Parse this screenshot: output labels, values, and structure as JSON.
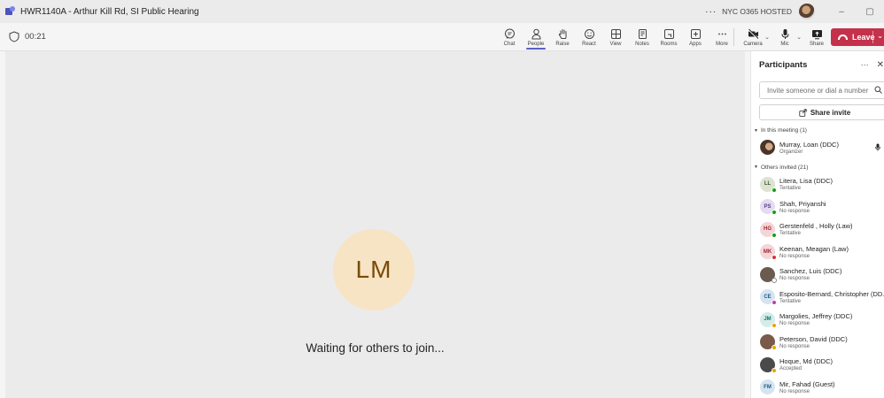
{
  "window": {
    "title": "HWR1140A - Arthur Kill Rd, SI Public Hearing",
    "more_label": "···",
    "org": "NYC O365 HOSTED",
    "minimize": "–",
    "restore": "▢"
  },
  "toolbar": {
    "timer": "00:21",
    "actions": [
      {
        "label": "Chat",
        "icon": "chat-icon"
      },
      {
        "label": "People",
        "icon": "people-icon",
        "active": true
      },
      {
        "label": "Raise",
        "icon": "hand-icon"
      },
      {
        "label": "React",
        "icon": "smile-icon"
      },
      {
        "label": "View",
        "icon": "grid-icon"
      },
      {
        "label": "Notes",
        "icon": "notes-icon"
      },
      {
        "label": "Rooms",
        "icon": "rooms-icon"
      },
      {
        "label": "Apps",
        "icon": "apps-icon"
      },
      {
        "label": "More",
        "icon": "more-icon"
      }
    ],
    "camera_label": "Camera",
    "mic_label": "Mic",
    "share_label": "Share",
    "leave_label": "Leave"
  },
  "stage": {
    "initials": "LM",
    "waiting_text": "Waiting for others to join..."
  },
  "participants": {
    "title": "Participants",
    "more": "···",
    "close": "✕",
    "invite_placeholder": "Invite someone or dial a number",
    "share_invite": "Share invite",
    "in_meeting_header": "In this meeting (1)",
    "in_meeting": [
      {
        "name": "Murray, Loan (DDC)",
        "status": "Organizer"
      }
    ],
    "others_header": "Others invited (21)",
    "others": [
      {
        "initials": "LL",
        "name": "Litera, Lisa (DDC)",
        "status": "Tentative",
        "bg": "#dce3d3",
        "fg": "#405b2e",
        "presence": "#13a10e"
      },
      {
        "initials": "PS",
        "name": "Shah, Priyanshi",
        "status": "No response",
        "bg": "#e3dcf0",
        "fg": "#5b3c88",
        "presence": "#13a10e"
      },
      {
        "initials": "HG",
        "name": "Gerstenfeld , Holly (Law)",
        "status": "Tentative",
        "bg": "#f3d6d8",
        "fg": "#a4262c",
        "presence": "#13a10e"
      },
      {
        "initials": "MK",
        "name": "Keenan, Meagan (Law)",
        "status": "No response",
        "bg": "#f3d6d8",
        "fg": "#a4262c",
        "presence": "#d13438"
      },
      {
        "initials": "",
        "name": "Sanchez, Luis (DDC)",
        "status": "No response",
        "bg": "#6b5a4e",
        "fg": "#fff",
        "presence": "#ffffff"
      },
      {
        "initials": "CE",
        "name": "Esposito-Bernard, Christopher (DD...",
        "status": "Tentative",
        "bg": "#d6e4f0",
        "fg": "#1d5a8a",
        "presence": "#c239b3"
      },
      {
        "initials": "JM",
        "name": "Margolies, Jeffrey (DDC)",
        "status": "No response",
        "bg": "#d6ece9",
        "fg": "#117865",
        "presence": "#eaa300"
      },
      {
        "initials": "",
        "name": "Peterson, David (DDC)",
        "status": "No response",
        "bg": "#7a5a48",
        "fg": "#fff",
        "presence": "#eaa300"
      },
      {
        "initials": "",
        "name": "Hoque, Md (DDC)",
        "status": "Accepted",
        "bg": "#4a4a4a",
        "fg": "#fff",
        "presence": "#eaa300"
      },
      {
        "initials": "FM",
        "name": "Mir, Fahad (Guest)",
        "status": "No response",
        "bg": "#d6e4f0",
        "fg": "#1d5a8a",
        "presence": ""
      }
    ]
  }
}
